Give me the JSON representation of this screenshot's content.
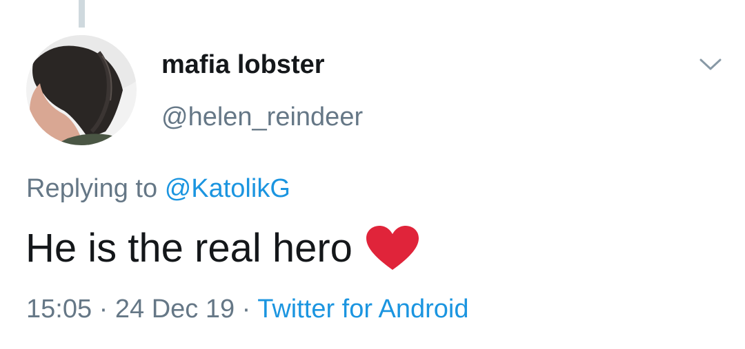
{
  "tweet": {
    "display_name": "mafia lobster",
    "handle": "@helen_reindeer",
    "replying_prefix": "Replying to",
    "replying_to": "@KatolikG",
    "text": "He is the real hero",
    "emoji": "heart-icon",
    "time": "15:05",
    "separator": "·",
    "date": "24 Dec 19",
    "source": "Twitter for Android"
  },
  "colors": {
    "link": "#1b95e0",
    "secondary_text": "#657786",
    "primary_text": "#14171a",
    "heart": "#e0243a"
  }
}
